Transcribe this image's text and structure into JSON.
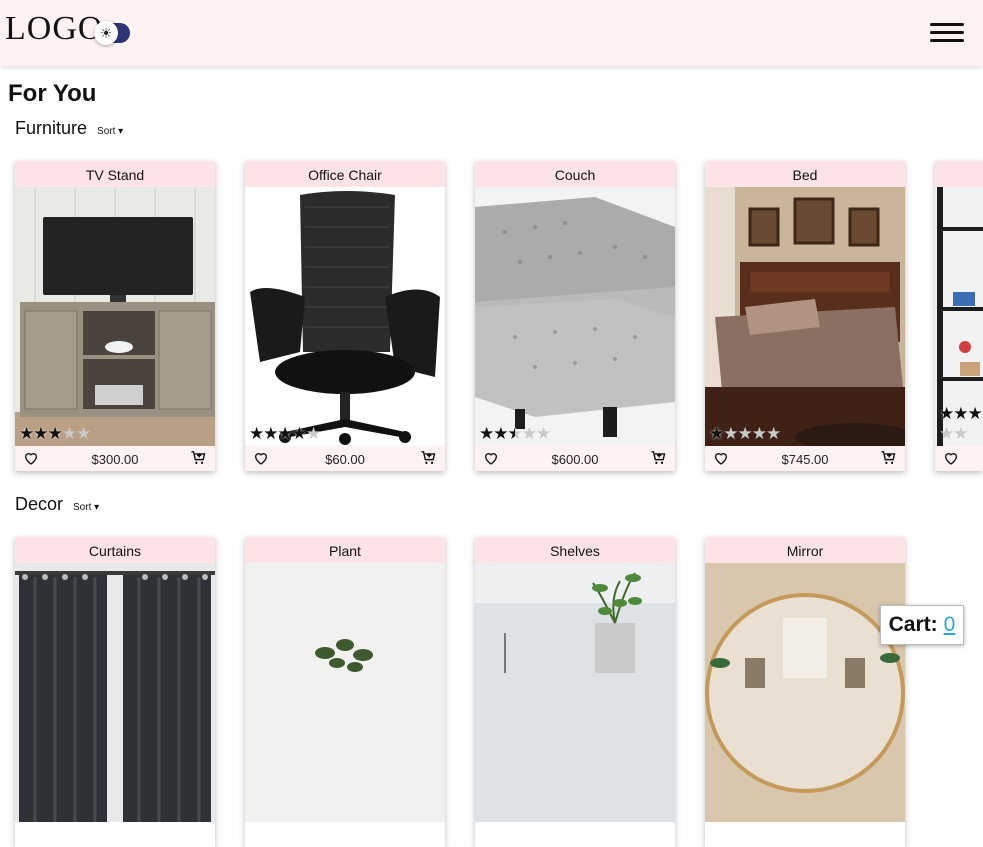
{
  "header": {
    "logo": "LOGO",
    "theme_toggle_icon": "sun-icon",
    "menu_icon": "hamburger-menu-icon"
  },
  "page": {
    "title": "For You"
  },
  "sections": [
    {
      "title": "Furniture",
      "sort_label": "Sort ▾",
      "products": [
        {
          "name": "TV Stand",
          "price": "$300.00",
          "rating": 3,
          "image": "tv-stand-image"
        },
        {
          "name": "Office Chair",
          "price": "$60.00",
          "rating": 4,
          "image": "office-chair-image"
        },
        {
          "name": "Couch",
          "price": "$600.00",
          "rating": 2.5,
          "image": "couch-image"
        },
        {
          "name": "Bed",
          "price": "$745.00",
          "rating": 1,
          "image": "bed-image"
        },
        {
          "name": "",
          "price": "",
          "rating": 3,
          "image": "bookshelf-image"
        }
      ]
    },
    {
      "title": "Decor",
      "sort_label": "Sort ▾",
      "products": [
        {
          "name": "Curtains",
          "image": "curtains-image"
        },
        {
          "name": "Plant",
          "image": "plant-image"
        },
        {
          "name": "Shelves",
          "image": "shelves-image"
        },
        {
          "name": "Mirror",
          "image": "mirror-image"
        }
      ]
    }
  ],
  "cart": {
    "label": "Cart:",
    "count": "0"
  },
  "colors": {
    "header_bg": "#fff2f3",
    "card_title_bg": "#ffe3e6",
    "toggle": "#2d3578",
    "cart_link": "#2aa7d8"
  }
}
